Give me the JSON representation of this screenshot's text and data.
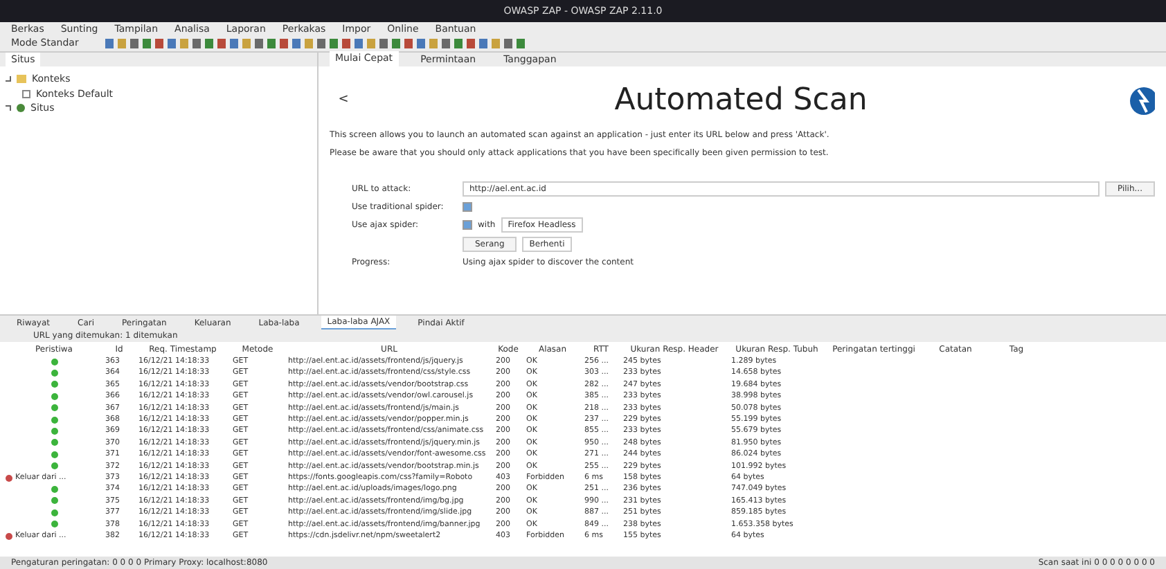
{
  "window": {
    "title": "OWASP ZAP - OWASP ZAP 2.11.0"
  },
  "menu": [
    "Berkas",
    "Sunting",
    "Tampilan",
    "Analisa",
    "Laporan",
    "Perkakas",
    "Impor",
    "Online",
    "Bantuan"
  ],
  "mode": {
    "value": "Mode Standar"
  },
  "left_tabs": [
    {
      "label": "Situs",
      "selected": true
    }
  ],
  "tree": [
    {
      "label": "Konteks",
      "expanded": true,
      "children": [
        {
          "label": "Konteks Default"
        }
      ]
    },
    {
      "label": "Situs",
      "expanded": false
    }
  ],
  "main_tabs": [
    {
      "label": "Mulai Cepat",
      "selected": true
    },
    {
      "label": "Permintaan",
      "selected": false
    },
    {
      "label": "Tanggapan",
      "selected": false
    }
  ],
  "scan": {
    "back": "<",
    "title": "Automated Scan",
    "intro": [
      "This screen allows you to launch an automated scan against an application - just enter its URL below and press 'Attack'.",
      "Please be aware that you should only attack applications that you have been specifically been given permission to test."
    ],
    "url_label": "URL to attack:",
    "url_value": "http://ael.ent.ac.id",
    "pick": "Pilih...",
    "traditional_label": "Use traditional spider:",
    "traditional_checked": true,
    "ajax_label": "Use ajax spider:",
    "ajax_checked": true,
    "ajax_with": "with",
    "browser": "Firefox Headless",
    "attack": "Serang",
    "stop": "Berhenti",
    "progress_label": "Progress:",
    "progress_value": "Using ajax spider to discover the content"
  },
  "bottom_tabs": [
    {
      "label": "Riwayat",
      "selected": false
    },
    {
      "label": "Cari",
      "selected": false
    },
    {
      "label": "Peringatan",
      "selected": false
    },
    {
      "label": "Keluaran",
      "selected": false
    },
    {
      "label": "Laba-laba",
      "selected": false
    },
    {
      "label": "Laba-laba AJAX",
      "selected": true
    },
    {
      "label": "Pindai Aktif",
      "selected": false
    }
  ],
  "filter": "URL yang ditemukan: 1 ditemukan",
  "table": {
    "columns": [
      "Peristiwa",
      "Id",
      "Req. Timestamp",
      "Metode",
      "URL",
      "Kode",
      "Alasan",
      "RTT",
      "Ukuran Resp. Header",
      "Ukuran Resp. Tubuh",
      "Peringatan tertinggi",
      "Catatan",
      "Tag"
    ],
    "rows": [
      {
        "ok": true,
        "event": "",
        "id": "363",
        "time": "16/12/21 14:18:33",
        "method": "GET",
        "url": "http://ael.ent.ac.id/assets/frontend/js/jquery.js",
        "code": "200",
        "reason": "OK",
        "rtt": "256 ...",
        "hdr": "245 bytes",
        "body": "1.289 bytes"
      },
      {
        "ok": true,
        "event": "",
        "id": "364",
        "time": "16/12/21 14:18:33",
        "method": "GET",
        "url": "http://ael.ent.ac.id/assets/frontend/css/style.css",
        "code": "200",
        "reason": "OK",
        "rtt": "303 ...",
        "hdr": "233 bytes",
        "body": "14.658 bytes"
      },
      {
        "ok": true,
        "event": "",
        "id": "365",
        "time": "16/12/21 14:18:33",
        "method": "GET",
        "url": "http://ael.ent.ac.id/assets/vendor/bootstrap.css",
        "code": "200",
        "reason": "OK",
        "rtt": "282 ...",
        "hdr": "247 bytes",
        "body": "19.684 bytes"
      },
      {
        "ok": true,
        "event": "",
        "id": "366",
        "time": "16/12/21 14:18:33",
        "method": "GET",
        "url": "http://ael.ent.ac.id/assets/vendor/owl.carousel.js",
        "code": "200",
        "reason": "OK",
        "rtt": "385 ...",
        "hdr": "233 bytes",
        "body": "38.998 bytes"
      },
      {
        "ok": true,
        "event": "",
        "id": "367",
        "time": "16/12/21 14:18:33",
        "method": "GET",
        "url": "http://ael.ent.ac.id/assets/frontend/js/main.js",
        "code": "200",
        "reason": "OK",
        "rtt": "218 ...",
        "hdr": "233 bytes",
        "body": "50.078 bytes"
      },
      {
        "ok": true,
        "event": "",
        "id": "368",
        "time": "16/12/21 14:18:33",
        "method": "GET",
        "url": "http://ael.ent.ac.id/assets/vendor/popper.min.js",
        "code": "200",
        "reason": "OK",
        "rtt": "237 ...",
        "hdr": "229 bytes",
        "body": "55.199 bytes"
      },
      {
        "ok": true,
        "event": "",
        "id": "369",
        "time": "16/12/21 14:18:33",
        "method": "GET",
        "url": "http://ael.ent.ac.id/assets/frontend/css/animate.css",
        "code": "200",
        "reason": "OK",
        "rtt": "855 ...",
        "hdr": "233 bytes",
        "body": "55.679 bytes"
      },
      {
        "ok": true,
        "event": "",
        "id": "370",
        "time": "16/12/21 14:18:33",
        "method": "GET",
        "url": "http://ael.ent.ac.id/assets/frontend/js/jquery.min.js",
        "code": "200",
        "reason": "OK",
        "rtt": "950 ...",
        "hdr": "248 bytes",
        "body": "81.950 bytes"
      },
      {
        "ok": true,
        "event": "",
        "id": "371",
        "time": "16/12/21 14:18:33",
        "method": "GET",
        "url": "http://ael.ent.ac.id/assets/vendor/font-awesome.css",
        "code": "200",
        "reason": "OK",
        "rtt": "271 ...",
        "hdr": "244 bytes",
        "body": "86.024 bytes"
      },
      {
        "ok": true,
        "event": "",
        "id": "372",
        "time": "16/12/21 14:18:33",
        "method": "GET",
        "url": "http://ael.ent.ac.id/assets/vendor/bootstrap.min.js",
        "code": "200",
        "reason": "OK",
        "rtt": "255 ...",
        "hdr": "229 bytes",
        "body": "101.992 bytes"
      },
      {
        "ok": false,
        "event": "Keluar dari ...",
        "id": "373",
        "time": "16/12/21 14:18:33",
        "method": "GET",
        "url": "https://fonts.googleapis.com/css?family=Roboto",
        "code": "403",
        "reason": "Forbidden",
        "rtt": "6 ms",
        "hdr": "158 bytes",
        "body": "64 bytes"
      },
      {
        "ok": true,
        "event": "",
        "id": "374",
        "time": "16/12/21 14:18:33",
        "method": "GET",
        "url": "http://ael.ent.ac.id/uploads/images/logo.png",
        "code": "200",
        "reason": "OK",
        "rtt": "251 ...",
        "hdr": "236 bytes",
        "body": "747.049 bytes"
      },
      {
        "ok": true,
        "event": "",
        "id": "375",
        "time": "16/12/21 14:18:33",
        "method": "GET",
        "url": "http://ael.ent.ac.id/assets/frontend/img/bg.jpg",
        "code": "200",
        "reason": "OK",
        "rtt": "990 ...",
        "hdr": "231 bytes",
        "body": "165.413 bytes"
      },
      {
        "ok": true,
        "event": "",
        "id": "377",
        "time": "16/12/21 14:18:33",
        "method": "GET",
        "url": "http://ael.ent.ac.id/assets/frontend/img/slide.jpg",
        "code": "200",
        "reason": "OK",
        "rtt": "887 ...",
        "hdr": "251 bytes",
        "body": "859.185 bytes"
      },
      {
        "ok": true,
        "event": "",
        "id": "378",
        "time": "16/12/21 14:18:33",
        "method": "GET",
        "url": "http://ael.ent.ac.id/assets/frontend/img/banner.jpg",
        "code": "200",
        "reason": "OK",
        "rtt": "849 ...",
        "hdr": "238 bytes",
        "body": "1.653.358 bytes"
      },
      {
        "ok": false,
        "event": "Keluar dari ...",
        "id": "382",
        "time": "16/12/21 14:18:33",
        "method": "GET",
        "url": "https://cdn.jsdelivr.net/npm/sweetalert2",
        "code": "403",
        "reason": "Forbidden",
        "rtt": "6 ms",
        "hdr": "155 bytes",
        "body": "64 bytes"
      }
    ]
  },
  "status_bar": {
    "left": "Pengaturan peringatan: 0 0 0 0 Primary Proxy: localhost:8080",
    "right": "Scan saat ini 0 0 0 0 0 0 0 0"
  }
}
